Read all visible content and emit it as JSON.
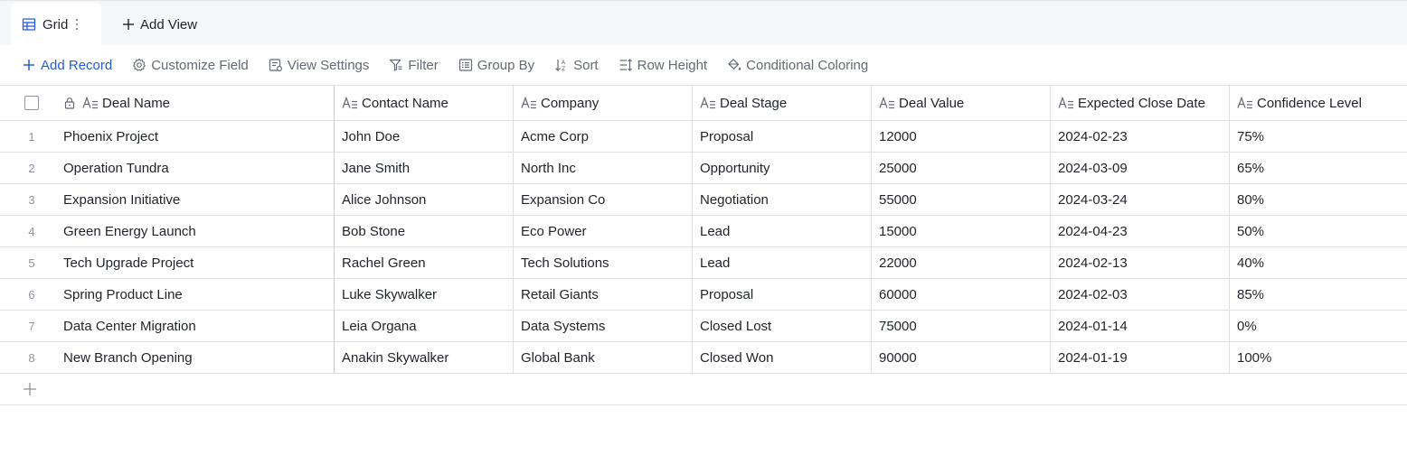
{
  "views": {
    "active": {
      "label": "Grid",
      "icon": "grid-table-icon"
    },
    "add_view_label": "Add View"
  },
  "toolbar": {
    "add_record": "Add Record",
    "customize_field": "Customize Field",
    "view_settings": "View Settings",
    "filter": "Filter",
    "group_by": "Group By",
    "sort": "Sort",
    "row_height": "Row Height",
    "conditional_coloring": "Conditional Coloring"
  },
  "colors": {
    "accent": "#245bdb",
    "muted": "#646a73",
    "border": "#dee0e3"
  },
  "columns": [
    "Deal Name",
    "Contact Name",
    "Company",
    "Deal Stage",
    "Deal Value",
    "Expected Close Date",
    "Confidence Level"
  ],
  "rows": [
    {
      "index": "1",
      "cells": [
        "Phoenix Project",
        "John Doe",
        "Acme Corp",
        "Proposal",
        "12000",
        "2024-02-23",
        "75%"
      ]
    },
    {
      "index": "2",
      "cells": [
        "Operation Tundra",
        "Jane Smith",
        "North Inc",
        "Opportunity",
        "25000",
        "2024-03-09",
        "65%"
      ]
    },
    {
      "index": "3",
      "cells": [
        "Expansion Initiative",
        "Alice Johnson",
        "Expansion Co",
        "Negotiation",
        "55000",
        "2024-03-24",
        "80%"
      ]
    },
    {
      "index": "4",
      "cells": [
        "Green Energy Launch",
        "Bob Stone",
        "Eco Power",
        "Lead",
        "15000",
        "2024-04-23",
        "50%"
      ]
    },
    {
      "index": "5",
      "cells": [
        "Tech Upgrade Project",
        "Rachel Green",
        "Tech Solutions",
        "Lead",
        "22000",
        "2024-02-13",
        "40%"
      ]
    },
    {
      "index": "6",
      "cells": [
        "Spring Product Line",
        "Luke Skywalker",
        "Retail Giants",
        "Proposal",
        "60000",
        "2024-02-03",
        "85%"
      ]
    },
    {
      "index": "7",
      "cells": [
        "Data Center Migration",
        "Leia Organa",
        "Data Systems",
        "Closed Lost",
        "75000",
        "2024-01-14",
        "0%"
      ]
    },
    {
      "index": "8",
      "cells": [
        "New Branch Opening",
        "Anakin Skywalker",
        "Global Bank",
        "Closed Won",
        "90000",
        "2024-01-19",
        "100%"
      ]
    }
  ]
}
